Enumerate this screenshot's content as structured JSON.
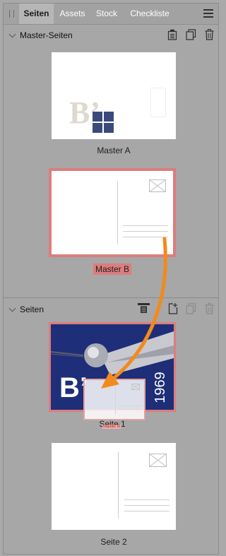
{
  "tabs": [
    {
      "label": "Seiten",
      "active": true
    },
    {
      "label": "Assets",
      "active": false
    },
    {
      "label": "Stock",
      "active": false
    },
    {
      "label": "Checkliste",
      "active": false
    }
  ],
  "master_section": {
    "title": "Master-Seiten",
    "items": [
      {
        "label": "Master A",
        "selected": false
      },
      {
        "label": "Master B",
        "selected": true
      }
    ]
  },
  "pages_section": {
    "title": "Seiten",
    "items": [
      {
        "label": "Seite 1",
        "selected": true,
        "drop_overlay_label": "Master B"
      },
      {
        "label": "Seite 2",
        "selected": false
      }
    ]
  },
  "thumbnail_art": {
    "master_a_logo": "B’",
    "seite1_logo": "B’",
    "seite1_year": "1969"
  },
  "colors": {
    "panel_bg": "#a7a7a7",
    "selection": "#dc7d7d",
    "drag_arrow": "#f28a1e",
    "poster_blue": "#1f2e78"
  },
  "icons": [
    "panel-grip-icon",
    "panel-menu-icon",
    "chevron-down-icon",
    "page-properties-icon",
    "duplicate-icon",
    "trash-icon",
    "apply-master-icon",
    "add-page-icon",
    "stamp-icon",
    "address-line-icon"
  ]
}
